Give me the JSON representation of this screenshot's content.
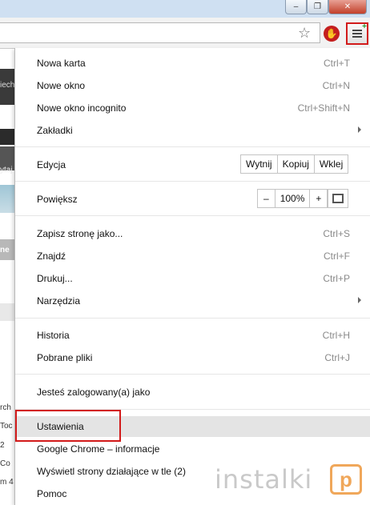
{
  "window": {
    "min_glyph": "–",
    "max_glyph": "❐",
    "close_glyph": "✕"
  },
  "toolbar": {
    "star_icon": "star-icon",
    "adblock_glyph": "✋",
    "menu_icon": "hamburger-menu-icon",
    "menu_badge": "+"
  },
  "page": {
    "fragments": [
      "iech",
      "ytaj",
      "ne",
      "rch",
      "Toc",
      "2",
      "Co",
      "m 4"
    ]
  },
  "menu": {
    "group1": [
      {
        "label": "Nowa karta",
        "shortcut": "Ctrl+T"
      },
      {
        "label": "Nowe okno",
        "shortcut": "Ctrl+N"
      },
      {
        "label": "Nowe okno incognito",
        "shortcut": "Ctrl+Shift+N"
      },
      {
        "label": "Zakładki",
        "shortcut": ""
      }
    ],
    "edit": {
      "label": "Edycja",
      "cut": "Wytnij",
      "copy": "Kopiuj",
      "paste": "Wklej"
    },
    "zoom": {
      "label": "Powiększ",
      "minus": "–",
      "value": "100%",
      "plus": "+"
    },
    "group2": [
      {
        "label": "Zapisz stronę jako...",
        "shortcut": "Ctrl+S"
      },
      {
        "label": "Znajdź",
        "shortcut": "Ctrl+F"
      },
      {
        "label": "Drukuj...",
        "shortcut": "Ctrl+P"
      },
      {
        "label": "Narzędzia",
        "shortcut": ""
      }
    ],
    "group3": [
      {
        "label": "Historia",
        "shortcut": "Ctrl+H"
      },
      {
        "label": "Pobrane pliki",
        "shortcut": "Ctrl+J"
      }
    ],
    "signin": "Jesteś zalogowany(a) jako",
    "group4": [
      {
        "label": "Ustawienia"
      },
      {
        "label": "Google Chrome – informacje"
      },
      {
        "label": "Wyświetl strony działające w tle (2)"
      },
      {
        "label": "Pomoc"
      }
    ]
  },
  "watermark": {
    "text": "instalki",
    "mark": "p"
  },
  "colors": {
    "highlight_box": "#d21a1a",
    "hover_row": "#e4e4e4",
    "accent_orange": "#f0a75a"
  }
}
